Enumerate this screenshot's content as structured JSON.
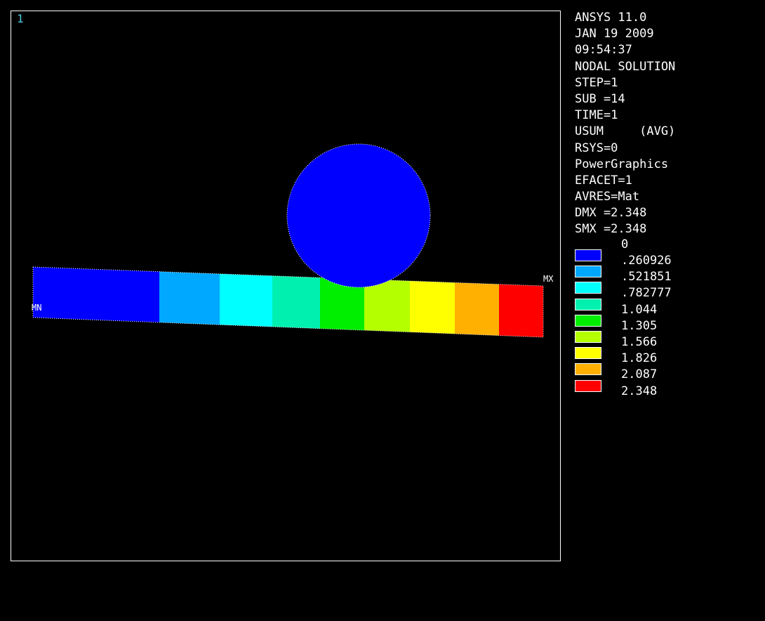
{
  "window_number": "1",
  "info": [
    "ANSYS 11.0",
    "JAN 19 2009",
    "09:54:37",
    "NODAL SOLUTION",
    "STEP=1",
    "SUB =14",
    "TIME=1",
    "USUM     (AVG)",
    "RSYS=0",
    "PowerGraphics",
    "EFACET=1",
    "AVRES=Mat",
    "DMX =2.348",
    "SMX =2.348"
  ],
  "legend": {
    "min_value": "0",
    "bands": [
      {
        "value": ".260926",
        "color": "#0000ff"
      },
      {
        "value": ".521851",
        "color": "#00a8ff"
      },
      {
        "value": ".782777",
        "color": "#00ffff"
      },
      {
        "value": "1.044",
        "color": "#00f0b0"
      },
      {
        "value": "1.305",
        "color": "#00ee00"
      },
      {
        "value": "1.566",
        "color": "#b4ff00"
      },
      {
        "value": "1.826",
        "color": "#ffff00"
      },
      {
        "value": "2.087",
        "color": "#ffb000"
      },
      {
        "value": "2.348",
        "color": "#ff0000"
      }
    ]
  },
  "labels": {
    "min": "MN",
    "max": "MX"
  },
  "roller_color": "#0000ff"
}
